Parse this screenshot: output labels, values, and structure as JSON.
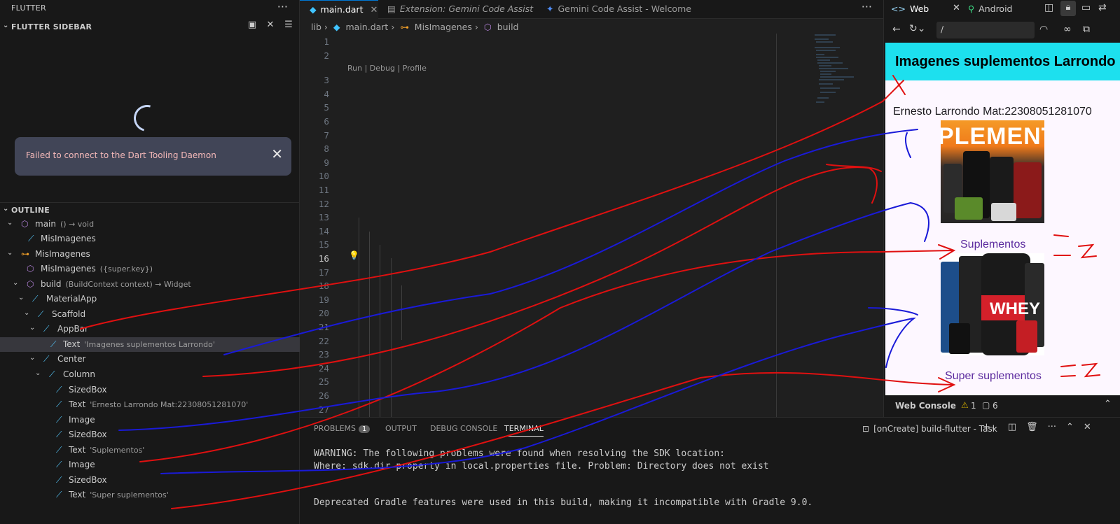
{
  "sidebar": {
    "title": "FLUTTER",
    "flutter_sidebar_label": "FLUTTER SIDEBAR",
    "toast_message": "Failed to connect to the Dart Tooling Daemon",
    "outline_label": "OUTLINE",
    "outline": [
      {
        "name": "main",
        "detail": "() → void",
        "icon": "cube-icon"
      },
      {
        "name": "MisImagenes",
        "detail": "",
        "icon": "flutter-icon"
      },
      {
        "name": "MisImagenes",
        "detail": "",
        "icon": "class-icon"
      },
      {
        "name": "MisImagenes",
        "detail": "({super.key})",
        "icon": "cube-icon"
      },
      {
        "name": "build",
        "detail": "(BuildContext context) → Widget",
        "icon": "cube-icon"
      },
      {
        "name": "MaterialApp",
        "detail": "",
        "icon": "flutter-icon"
      },
      {
        "name": "Scaffold",
        "detail": "",
        "icon": "flutter-icon"
      },
      {
        "name": "AppBar",
        "detail": "",
        "icon": "flutter-icon"
      },
      {
        "name": "Text",
        "detail": "'Imagenes suplementos Larrondo'",
        "icon": "flutter-icon"
      },
      {
        "name": "Center",
        "detail": "",
        "icon": "flutter-icon"
      },
      {
        "name": "Column",
        "detail": "",
        "icon": "flutter-icon"
      },
      {
        "name": "SizedBox",
        "detail": "",
        "icon": "flutter-icon"
      },
      {
        "name": "Text",
        "detail": "'Ernesto Larrondo Mat:22308051281070'",
        "icon": "flutter-icon"
      },
      {
        "name": "Image",
        "detail": "",
        "icon": "flutter-icon"
      },
      {
        "name": "SizedBox",
        "detail": "",
        "icon": "flutter-icon"
      },
      {
        "name": "Text",
        "detail": "'Suplementos'",
        "icon": "flutter-icon"
      },
      {
        "name": "Image",
        "detail": "",
        "icon": "flutter-icon"
      },
      {
        "name": "SizedBox",
        "detail": "",
        "icon": "flutter-icon"
      },
      {
        "name": "Text",
        "detail": "'Super suplementos'",
        "icon": "flutter-icon"
      }
    ]
  },
  "editor": {
    "tabs": [
      {
        "label": "main.dart",
        "icon": "dart-icon",
        "active": true
      },
      {
        "label": "Extension: Gemini Code Assist",
        "icon": "extension-icon",
        "active": false
      },
      {
        "label": "Gemini Code Assist - Welcome",
        "icon": "gemini-icon",
        "active": false
      }
    ],
    "breadcrumb": [
      "lib",
      "main.dart",
      "MisImagenes",
      "build"
    ],
    "codelens": "Run | Debug | Profile",
    "current_line": 16,
    "line_numbers": [
      "1",
      "2",
      "3",
      "4",
      "5",
      "6",
      "7",
      "8",
      "9",
      "10",
      "11",
      "12",
      "13",
      "14",
      "15",
      "16",
      "17",
      "18",
      "19",
      "20",
      "21",
      "22",
      "23",
      "24",
      "25",
      "26",
      "27"
    ]
  },
  "panel": {
    "tabs": [
      "PROBLEMS",
      "OUTPUT",
      "DEBUG CONSOLE",
      "TERMINAL"
    ],
    "problems_count": "1",
    "task_label": "[onCreate] build-flutter - Task",
    "terminal_lines": [
      "WARNING: The following problems were found when resolving the SDK location:",
      "Where: sdk.dir property in local.properties file. Problem: Directory does not exist",
      "",
      "Deprecated Gradle features were used in this build, making it incompatible with Gradle 9.0."
    ]
  },
  "preview": {
    "tabs": [
      {
        "label": "Web",
        "active": true
      },
      {
        "label": "Android",
        "active": false
      }
    ],
    "url": "/",
    "app_title": "Imagenes suplementos Larrondo",
    "author_text": "Ernesto Larrondo Mat:22308051281070",
    "caption1": "Suplementos",
    "caption2": "Super suplementos",
    "img1_text": "PLEMENT",
    "img2_text": "WHEY",
    "web_console": "Web Console",
    "warnings": "1",
    "info": "6",
    "appbar_color": "#1de0ee",
    "caption_color": "#5b2a9e"
  }
}
